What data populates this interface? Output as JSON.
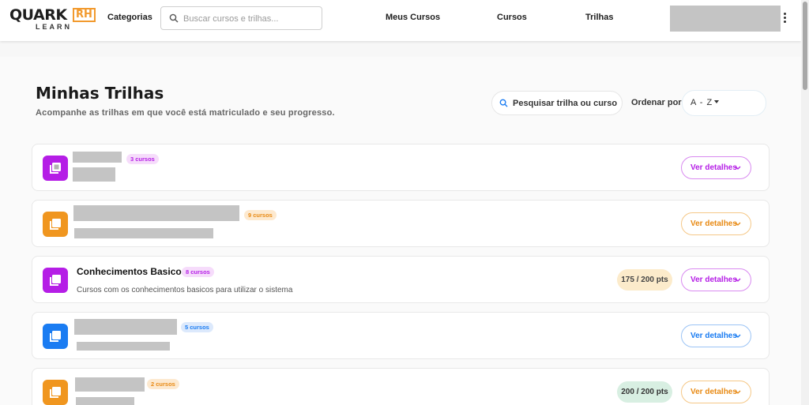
{
  "header": {
    "logo_text": "QUARK",
    "logo_badge": "RH",
    "logo_sub": "LEARN",
    "categories": "Categorias",
    "search_placeholder": "Buscar cursos e trilhas...",
    "nav": [
      "Meus Cursos",
      "Cursos",
      "Trilhas"
    ]
  },
  "page": {
    "title": "Minhas Trilhas",
    "subtitle": "Acompanhe as trilhas em que você está matriculado e seu progresso.",
    "filter_placeholder": "Pesquisar trilha ou curso",
    "sort_label": "Ordenar por",
    "sort_value": "A - Z"
  },
  "colors": {
    "purple": "#b51ee6",
    "orange": "#f0961f",
    "blue": "#1a7cf2",
    "pts_yellow_bg": "#fcebcb",
    "pts_green_bg": "#d8efe2"
  },
  "trails": [
    {
      "color": "purple",
      "title": "",
      "badge": "3 cursos",
      "description": "",
      "points": "",
      "details": "Ver detalhes",
      "icon": "stacked-pages-icon"
    },
    {
      "color": "orange",
      "title": "",
      "badge": "9 cursos",
      "description": "",
      "points": "",
      "details": "Ver detalhes",
      "icon": "stacked-pages-icon"
    },
    {
      "color": "purple",
      "title": "Conhecimentos Basicos",
      "badge": "8 cursos",
      "description": "Cursos com os conhecimentos basicos para utilizar o sistema",
      "points": "175 / 200 pts",
      "details": "Ver detalhes",
      "icon": "stacked-pages-icon"
    },
    {
      "color": "blue",
      "title": "",
      "badge": "5 cursos",
      "description": "",
      "points": "",
      "details": "Ver detalhes",
      "icon": "stacked-pages-icon"
    },
    {
      "color": "orange",
      "title": "",
      "badge": "2 cursos",
      "description": "",
      "points": "200 / 200 pts",
      "details": "Ver detalhes",
      "icon": "stacked-pages-icon"
    }
  ]
}
